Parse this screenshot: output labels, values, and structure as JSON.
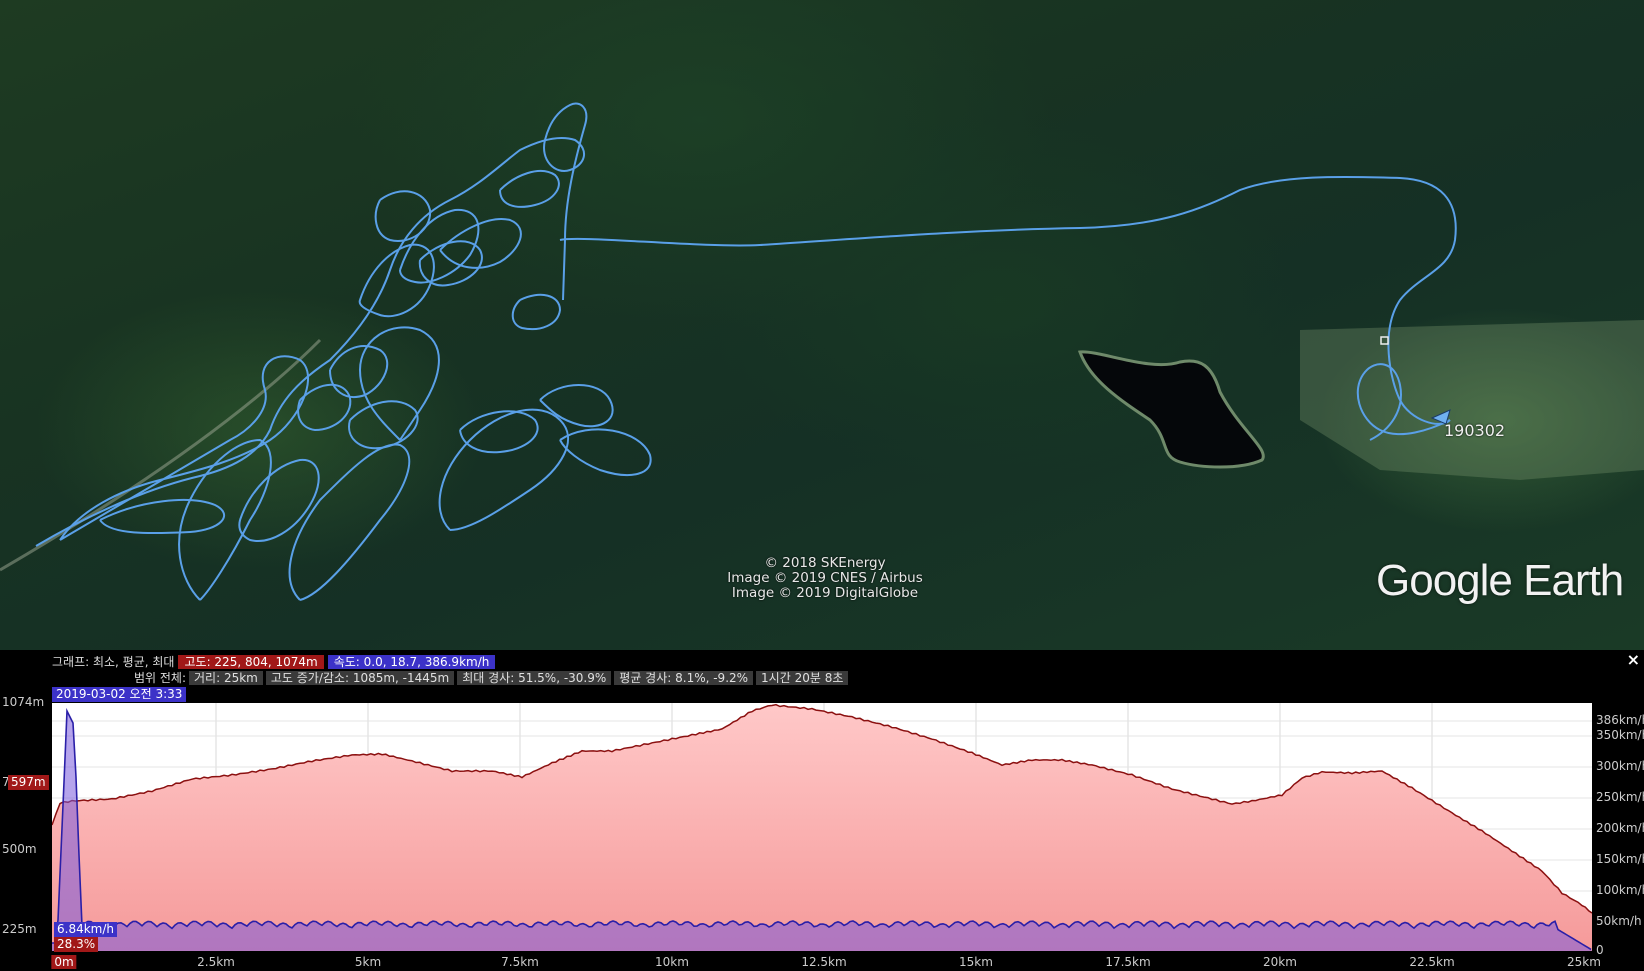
{
  "map": {
    "credits": [
      "© 2018 SKEnergy",
      "Image © 2019 CNES / Airbus",
      "Image © 2019 DigitalGlobe"
    ],
    "brand": "Google Earth",
    "placemark_label": "190302",
    "track_color": "#5aa0e8"
  },
  "profile": {
    "graph_label": "그래프: 최소, 평균, 최대",
    "altitude_stats": "고도: 225, 804, 1074m",
    "speed_stats": "속도: 0.0, 18.7, 386.9km/h",
    "range_label": "범위 전체:",
    "distance": "거리: 25km",
    "climb": "고도 증가/감소: 1085m, -1445m",
    "max_slope": "최대 경사: 51.5%, -30.9%",
    "avg_slope": "평균 경사: 8.1%, -9.2%",
    "duration": "1시간 20분 8초",
    "close_label": "×",
    "date_time": "2019-03-02 오전 3:33",
    "y_left_labels": [
      "1074m",
      "750m",
      "500m",
      "225m"
    ],
    "y_right_labels": [
      "386km/h",
      "350km/h",
      "300km/h",
      "250km/h",
      "200km/h",
      "150km/h",
      "100km/h",
      "50km/h",
      "0"
    ],
    "x_labels": [
      "0m",
      "2.5km",
      "5km",
      "7.5km",
      "10km",
      "12.5km",
      "15km",
      "17.5km",
      "20km",
      "22.5km",
      "25km"
    ],
    "cursor_altitude": "597m",
    "cursor_speed": "6.84km/h",
    "cursor_slope": "28.3%",
    "altitude_color": "#8b1010",
    "speed_color": "#2a1fa8"
  }
}
